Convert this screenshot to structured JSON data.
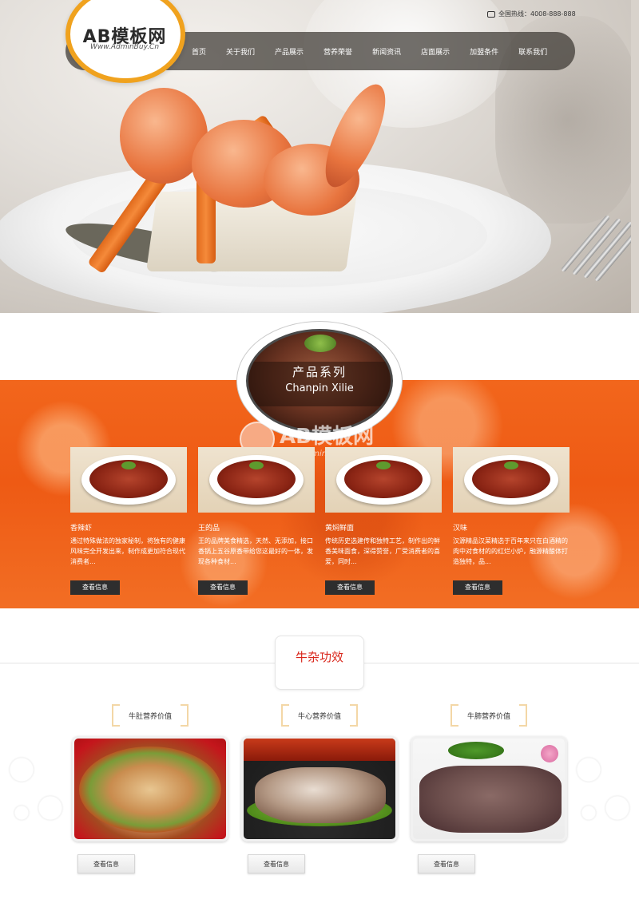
{
  "header": {
    "logo_title": "AB模板网",
    "logo_subtitle": "Www.AdminBuy.Cn",
    "phone_label": "全国热线：4008-888-888",
    "nav": [
      "首页",
      "关于我们",
      "产品展示",
      "营养荣誉",
      "新闻资讯",
      "店面展示",
      "加盟条件",
      "联系我们"
    ]
  },
  "products": {
    "title": "产品系列",
    "subtitle": "Chanpin Xilie",
    "watermark_title": "AB模板网",
    "watermark_subtitle": "www.AdminBuy.Cn",
    "items": [
      {
        "name": "香辣虾",
        "desc": "通过特殊做法的独家秘制，将独有的健康风味完全开发出来，制作成更加符合现代消费者...",
        "button": "查看信息"
      },
      {
        "name": "王的品",
        "desc": "王的品牌美食精选，天然、无添加，接口香锅上五谷原香带给您这最好的一体，发现各种食材...",
        "button": "查看信息"
      },
      {
        "name": "黄焖鲜面",
        "desc": "传统历史选建传和独特工艺，制作出的鲜香美味面食，深得赞誉，广受消费者的喜爱，同时...",
        "button": "查看信息"
      },
      {
        "name": "汉味",
        "desc": "汉源精品汉菜精选于百年来只在白酒精的肉中对食材的的红烂小炉，融源精酿体打造独特，品...",
        "button": "查看信息"
      }
    ]
  },
  "efficacy": {
    "title": "牛杂功效",
    "items": [
      {
        "label": "牛肚营养价值",
        "button": "查看信息"
      },
      {
        "label": "牛心营养价值",
        "button": "查看信息"
      },
      {
        "label": "牛肺营养价值",
        "button": "查看信息"
      }
    ]
  },
  "colors": {
    "accent_orange": "#f0a21e",
    "section_orange": "#ee5a14",
    "title_red": "#d9271c",
    "button_dark": "#2e2e2e"
  }
}
